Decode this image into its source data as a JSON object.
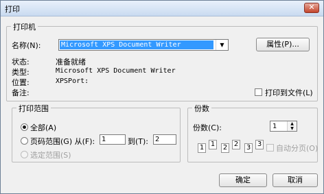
{
  "window": {
    "title": "打印",
    "close_glyph": "✕"
  },
  "printer_group": {
    "title": "打印机",
    "name_label": "名称(N):",
    "name_value": "Microsoft XPS Document Writer",
    "properties_button": "属性(P)...",
    "status_label": "状态:",
    "status_value": "准备就绪",
    "type_label": "类型:",
    "type_value": "Microsoft XPS Document Writer",
    "location_label": "位置:",
    "location_value": "XPSPort:",
    "comment_label": "备注:",
    "comment_value": "",
    "print_to_file": {
      "label": "打印到文件(L)",
      "checked": false
    }
  },
  "range_group": {
    "title": "打印范围",
    "all_label": "全部(A)",
    "pages_label": "页码范围(G) 从(F):",
    "pages_from": "1",
    "to_label": "到(T):",
    "pages_to": "2",
    "selection_label": "选定范围(S)",
    "selected": "all"
  },
  "copies_group": {
    "title": "份数",
    "copies_label": "份数(C):",
    "copies_value": "1",
    "collate_label": "自动分页(O)",
    "collate_checked": false,
    "collate_pages": [
      "1",
      "1",
      "2",
      "2",
      "3",
      "3"
    ]
  },
  "buttons": {
    "ok": "确定",
    "cancel": "取消"
  },
  "icons": {
    "dropdown": "chevron-down-icon",
    "spin": "spin-arrows-icon",
    "collate": "collate-pages-icon"
  }
}
